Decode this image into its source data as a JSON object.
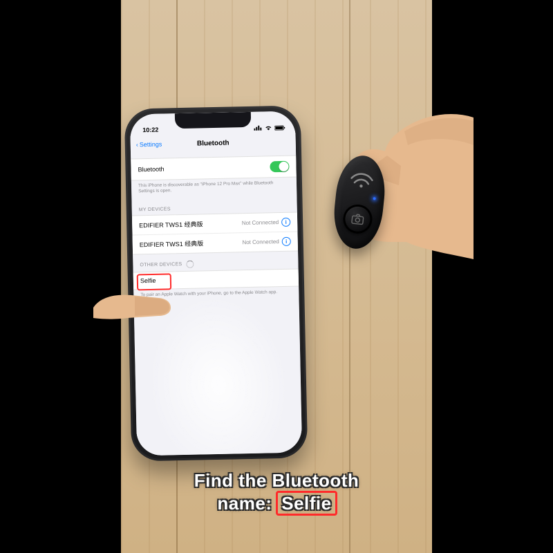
{
  "status_bar": {
    "time": "10:22"
  },
  "nav": {
    "back": "Settings",
    "title": "Bluetooth"
  },
  "bluetooth": {
    "label": "Bluetooth",
    "discoverable_note": "This iPhone is discoverable as \"iPhone 12 Pro Max\" while Bluetooth Settings is open."
  },
  "my_devices": {
    "header": "MY DEVICES",
    "items": [
      {
        "name": "EDIFIER TWS1 经典版",
        "status": "Not Connected"
      },
      {
        "name": "EDIFIER TWS1 经典版",
        "status": "Not Connected"
      }
    ]
  },
  "other_devices": {
    "header": "OTHER DEVICES",
    "items": [
      {
        "name": "Selfie"
      }
    ],
    "watch_note": "To pair an Apple Watch with your iPhone, go to the Apple Watch app."
  },
  "caption": {
    "line1": "Find the Bluetooth",
    "line2a": "name:",
    "line2b": "Selfie"
  }
}
